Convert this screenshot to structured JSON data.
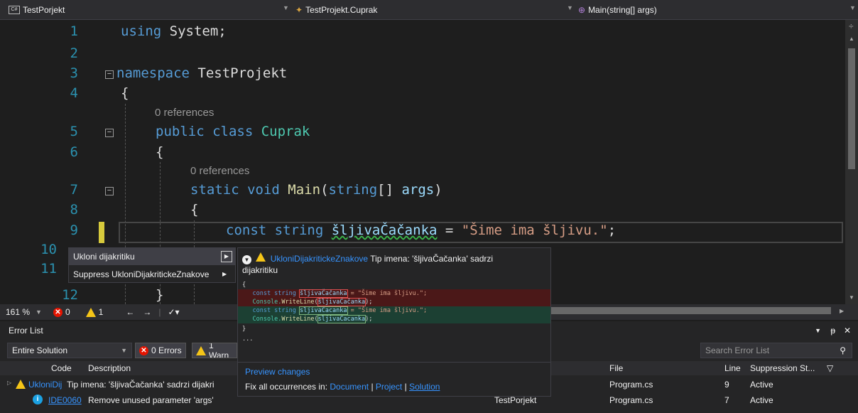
{
  "navbar": {
    "project": "TestPorjekt",
    "type": "TestProjekt.Cuprak",
    "member": "Main(string[] args)"
  },
  "code": {
    "line_numbers": [
      "1",
      "2",
      "3",
      "4",
      "5",
      "6",
      "7",
      "8",
      "9",
      "10",
      "11",
      "12"
    ],
    "l1_kw": "using",
    "l1_rest": " System;",
    "l3_kw": "namespace",
    "l3_rest": " TestProjekt",
    "l4": "{",
    "lens1": "0 references",
    "l5_kw": "public class",
    "l5_ty": "Cuprak",
    "l6": "{",
    "lens2": "0 references",
    "l7_kw": "static void",
    "l7_fn": "Main",
    "l7_p1": "(",
    "l7_kw2": "string",
    "l7_p2": "[] ",
    "l7_id": "args",
    "l7_p3": ")",
    "l8": "{",
    "l9_kw": "const string",
    "l9_id": "šljivaČačanka",
    "l9_eq": " = ",
    "l9_st": "\"Šime ima šljivu.\"",
    "l9_end": ";",
    "l12": "}"
  },
  "status": {
    "zoom": "161 %",
    "errors": "0",
    "warnings": "1"
  },
  "quick_actions": {
    "item1": "Ukloni dijakritiku",
    "item2": "Suppress UkloniDijakritickeZnakove"
  },
  "preview": {
    "rule_id": "UkloniDijakritickeZnakove",
    "message": "Tip imena: 'šljivaČačanka' sadrzi",
    "message2": "dijakritiku",
    "c_open": "{",
    "rm1_a": "    const string ",
    "rm1_b": "šljivaČačanka",
    "rm1_c": " = \"Šime ima šljivu.\";",
    "rm2_a": "    Console.",
    "rm2_b": "WriteLine",
    "rm2_c": "(",
    "rm2_d": "šljivaČačanka",
    "rm2_e": ");",
    "ad1_a": "    const string ",
    "ad1_b": "sljivaCacanka",
    "ad1_c": " = \"Šime ima šljivu.\";",
    "ad2_a": "    Console.",
    "ad2_b": "WriteLine",
    "ad2_c": "(",
    "ad2_d": "sljivaCacanka",
    "ad2_e": ");",
    "c_close": "}",
    "ellipsis": "...",
    "preview_link": "Preview changes",
    "fix_all": "Fix all occurrences in:",
    "document": "Document",
    "sep1": "|",
    "project": "Project",
    "sep2": "|",
    "solution": "Solution"
  },
  "error_list": {
    "title": "Error List",
    "scope": "Entire Solution",
    "errors_btn": "0 Errors",
    "warnings_btn": "1 Warn",
    "search_placeholder": "Search Error List",
    "columns": {
      "code": "Code",
      "description": "Description",
      "file": "File",
      "line": "Line",
      "suppression": "Suppression St..."
    },
    "rows": [
      {
        "code": "UkloniDij",
        "description": "Tip imena: 'šljivaČačanka' sadrzi dijakri",
        "project": "",
        "file": "Program.cs",
        "line": "9",
        "suppression": "Active"
      },
      {
        "code": "IDE0060",
        "description": "Remove unused parameter 'args'",
        "project": "TestPorjekt",
        "file": "Program.cs",
        "line": "7",
        "suppression": "Active"
      }
    ]
  }
}
